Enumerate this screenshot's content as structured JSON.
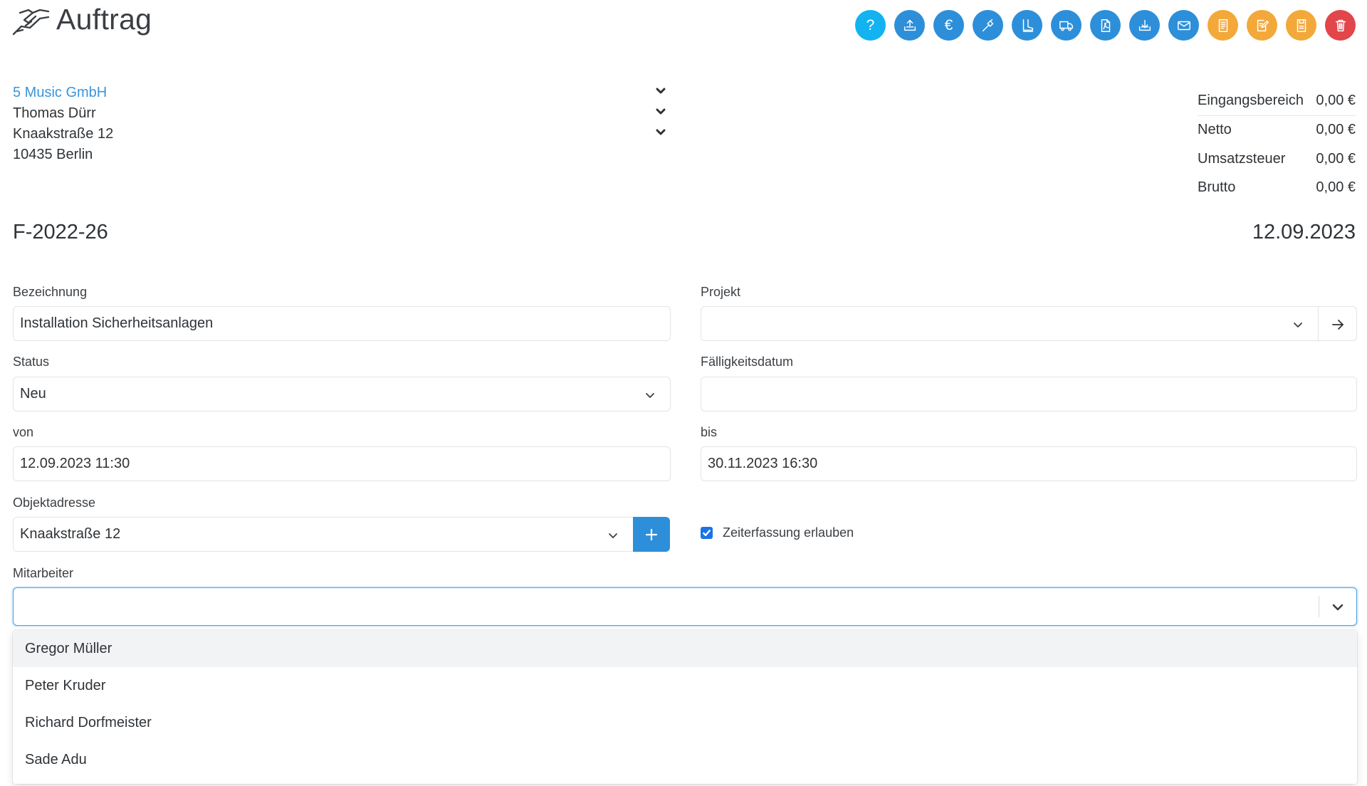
{
  "header": {
    "title": "Auftrag",
    "toolbar": [
      {
        "icon": "help-icon",
        "glyph": "?",
        "color": "#12b3f0"
      },
      {
        "icon": "upload-icon",
        "color": "#2d8fd9"
      },
      {
        "icon": "euro-icon",
        "glyph": "€",
        "color": "#2d8fd9"
      },
      {
        "icon": "hammer-icon",
        "color": "#2d8fd9"
      },
      {
        "icon": "boot-icon",
        "color": "#2d8fd9"
      },
      {
        "icon": "truck-icon",
        "color": "#2d8fd9"
      },
      {
        "icon": "pdf-icon",
        "color": "#2d8fd9"
      },
      {
        "icon": "download-icon",
        "color": "#2d8fd9"
      },
      {
        "icon": "mail-icon",
        "color": "#2d8fd9"
      },
      {
        "icon": "document-icon",
        "color": "#f3a83a"
      },
      {
        "icon": "edit-icon",
        "color": "#f3a83a"
      },
      {
        "icon": "save-icon",
        "color": "#f3a83a"
      },
      {
        "icon": "trash-icon",
        "color": "#e2454a"
      }
    ]
  },
  "customer": {
    "company": "5 Music GmbH",
    "contact": "Thomas Dürr",
    "street": "Knaakstraße 12",
    "city": "10435 Berlin"
  },
  "totals": [
    {
      "label": "Eingangsbereich",
      "value": "0,00 €"
    },
    {
      "label": "Netto",
      "value": "0,00 €"
    },
    {
      "label": "Umsatzsteuer",
      "value": "0,00 €"
    },
    {
      "label": "Brutto",
      "value": "0,00 €"
    }
  ],
  "document": {
    "number": "F-2022-26",
    "date": "12.09.2023"
  },
  "form": {
    "bezeichnung": {
      "label": "Bezeichnung",
      "value": "Installation Sicherheitsanlagen"
    },
    "projekt": {
      "label": "Projekt",
      "value": ""
    },
    "status": {
      "label": "Status",
      "value": "Neu"
    },
    "faelligkeitsdatum": {
      "label": "Fälligkeitsdatum",
      "value": ""
    },
    "von": {
      "label": "von",
      "value": "12.09.2023 11:30"
    },
    "bis": {
      "label": "bis",
      "value": "30.11.2023 16:30"
    },
    "objektadresse": {
      "label": "Objektadresse",
      "value": "Knaakstraße 12"
    },
    "zeiterfassung": {
      "label": "Zeiterfassung erlauben",
      "checked": true
    },
    "mitarbeiter": {
      "label": "Mitarbeiter",
      "value": "",
      "options": [
        "Gregor Müller",
        "Peter Kruder",
        "Richard Dorfmeister",
        "Sade Adu"
      ]
    }
  },
  "colors": {
    "accent": "#2d8fd9",
    "link": "#3a95d9",
    "help": "#12b3f0",
    "warning": "#f3a83a",
    "danger": "#e2454a"
  }
}
